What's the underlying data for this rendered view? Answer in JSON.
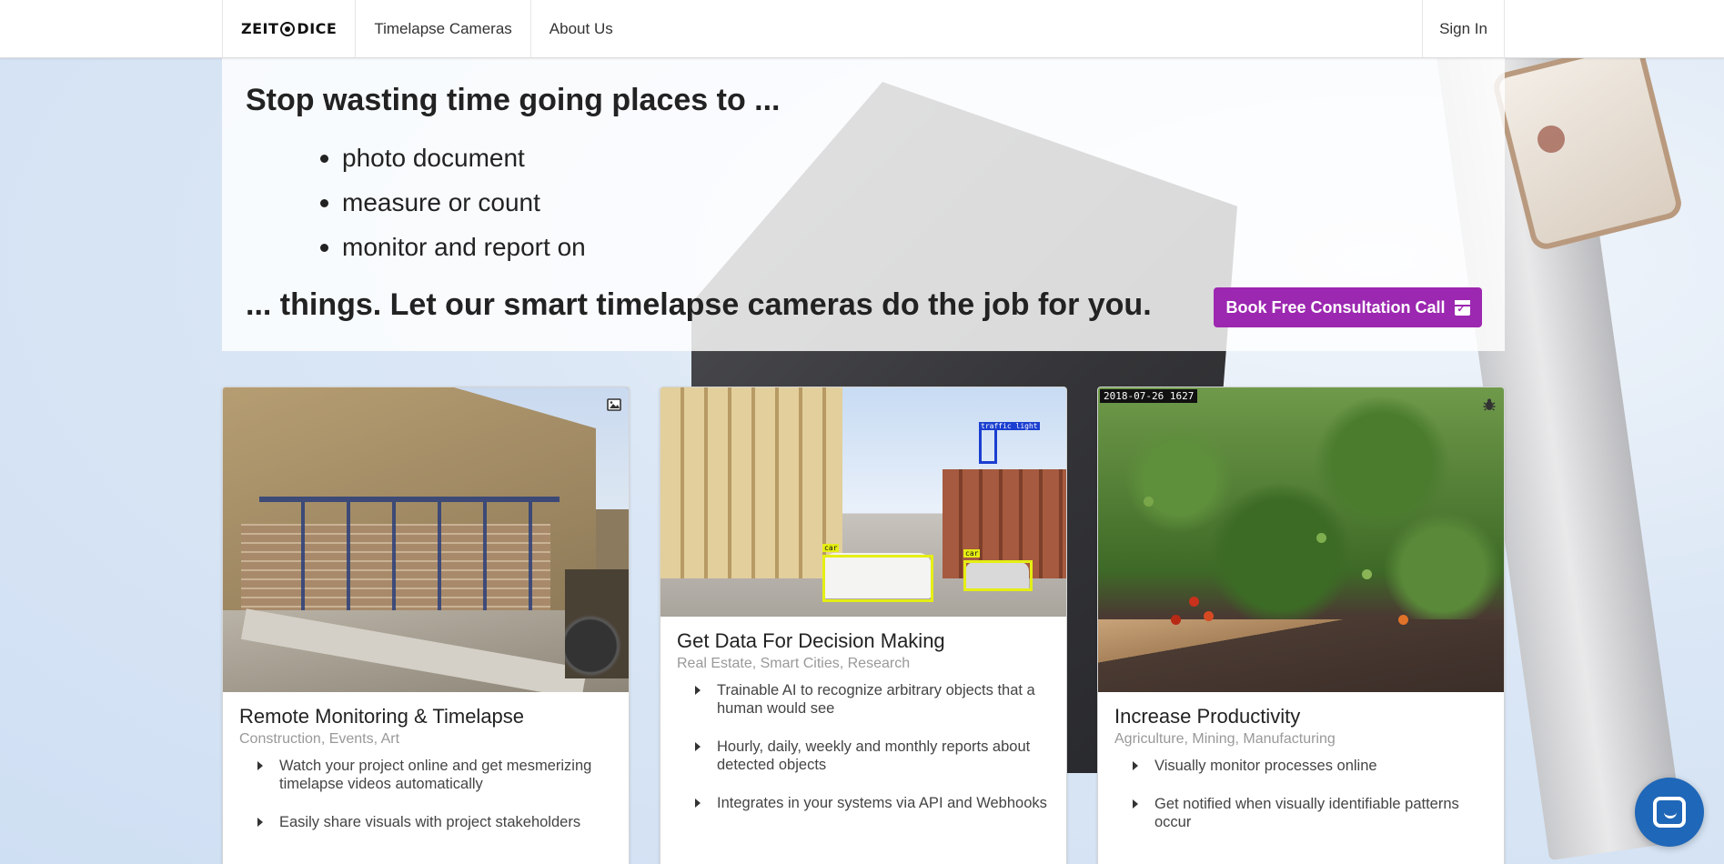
{
  "navbar": {
    "logo": "ZEIT",
    "logo_suffix": "DICE",
    "items": [
      {
        "label": "Timelapse Cameras"
      },
      {
        "label": "About Us"
      }
    ],
    "sign_in": "Sign In"
  },
  "hero": {
    "headline": "Stop wasting time going places to ...",
    "bullets": [
      "photo document",
      "measure or count",
      "monitor and report on"
    ],
    "tagline": "... things. Let our smart timelapse cameras do the job for you.",
    "cta": "Book Free Consultation Call",
    "cta_color": "#9c27b0"
  },
  "cards": [
    {
      "title": "Remote Monitoring & Timelapse",
      "meta": "Construction, Events, Art",
      "corner_icon": "image-icon",
      "points": [
        "Watch your project online and get mesmerizing timelapse videos automatically",
        "Easily share visuals with project stakeholders"
      ]
    },
    {
      "title": "Get Data For Decision Making",
      "meta": "Real Estate, Smart Cities, Research",
      "image_labels": [
        "traffic light",
        "car",
        "car"
      ],
      "points": [
        "Trainable AI to recognize arbitrary objects that a human would see",
        "Hourly, daily, weekly and monthly reports about detected objects",
        "Integrates in your systems via API and Webhooks"
      ]
    },
    {
      "title": "Increase Productivity",
      "meta": "Agriculture, Mining, Manufacturing",
      "corner_icon": "bug-icon",
      "image_timestamp": "2018-07-26 1627",
      "points": [
        "Visually monitor processes online",
        "Get notified when visually identifiable patterns occur"
      ]
    }
  ],
  "chat": {
    "icon": "chat-icon",
    "color": "#1f67b8"
  }
}
